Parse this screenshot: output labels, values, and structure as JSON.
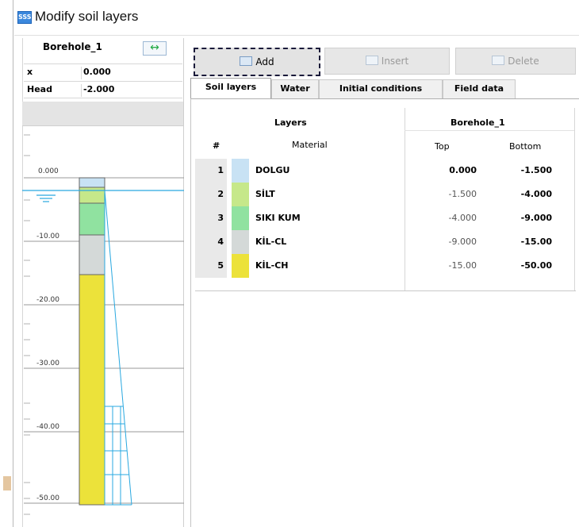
{
  "window": {
    "title": "Modify soil layers",
    "icon_label": "SSS"
  },
  "borehole_panel": {
    "name": "Borehole_1",
    "fields": [
      {
        "label": "x",
        "value": "0.000"
      },
      {
        "label": "Head",
        "value": "-2.000"
      }
    ],
    "depth_labels": [
      "0.000",
      "-10.00",
      "-20.00",
      "-30.00",
      "-40.00",
      "-50.00"
    ]
  },
  "toolbar": {
    "add_label": "Add",
    "insert_label": "Insert",
    "delete_label": "Delete"
  },
  "tabs": [
    {
      "label": "Soil layers",
      "active": true
    },
    {
      "label": "Water",
      "active": false
    },
    {
      "label": "Initial conditions",
      "active": false
    },
    {
      "label": "Field data",
      "active": false
    }
  ],
  "table": {
    "group_header_layers": "Layers",
    "group_header_borehole": "Borehole_1",
    "col_num": "#",
    "col_material": "Material",
    "col_top": "Top",
    "col_bottom": "Bottom",
    "rows": [
      {
        "num": "1",
        "material": "DOLGU",
        "top": "0.000",
        "bottom": "-1.500",
        "color": "#c8e2f4",
        "top_bold": true
      },
      {
        "num": "2",
        "material": "SİLT",
        "top": "-1.500",
        "bottom": "-4.000",
        "color": "#c6e88a",
        "top_bold": false
      },
      {
        "num": "3",
        "material": "SIKI KUM",
        "top": "-4.000",
        "bottom": "-9.000",
        "color": "#90e2a0",
        "top_bold": false
      },
      {
        "num": "4",
        "material": "KİL-CL",
        "top": "-9.000",
        "bottom": "-15.00",
        "color": "#d4d9d8",
        "top_bold": false
      },
      {
        "num": "5",
        "material": "KİL-CH",
        "top": "-15.00",
        "bottom": "-50.00",
        "color": "#ece23a",
        "top_bold": false
      }
    ]
  },
  "colors": {
    "water_line": "#29a8e0",
    "tab_border": "#a0a0a0",
    "row_header_bg": "#e9e9e9"
  }
}
